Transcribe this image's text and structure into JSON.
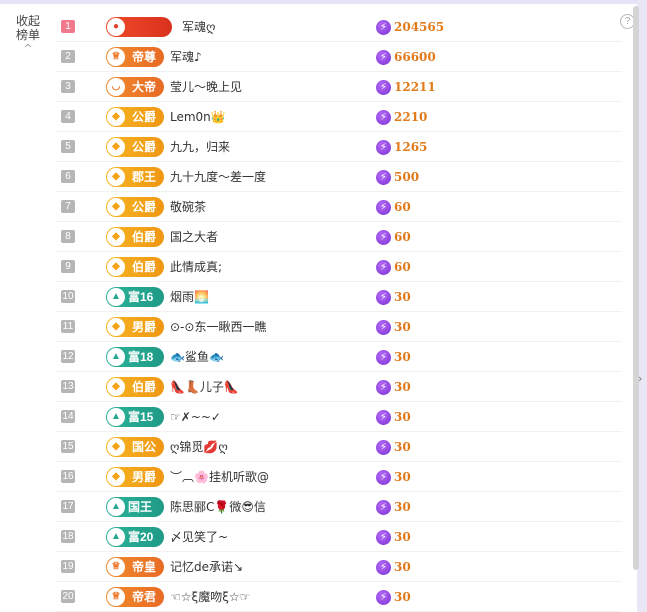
{
  "sidebar": {
    "collapse_label": "收起\n榜单",
    "caret": "^"
  },
  "help_icon": "?",
  "entries": [
    {
      "rank": "1",
      "badge": "",
      "style": "red",
      "icon": "●",
      "name": "军魂ღ",
      "points": "204565"
    },
    {
      "rank": "2",
      "badge": "帝尊",
      "style": "orange",
      "icon": "♕",
      "name": "军魂♪",
      "points": "66600"
    },
    {
      "rank": "3",
      "badge": "大帝",
      "style": "orange",
      "icon": "◡",
      "name": "莹儿～晚上见",
      "points": "12211"
    },
    {
      "rank": "4",
      "badge": "公爵",
      "style": "gold",
      "icon": "◆",
      "name": "Lem0n👑",
      "points": "2210"
    },
    {
      "rank": "5",
      "badge": "公爵",
      "style": "gold",
      "icon": "◆",
      "name": "九九，归来",
      "points": "1265"
    },
    {
      "rank": "6",
      "badge": "郡王",
      "style": "gold",
      "icon": "◆",
      "name": "九十九度～差一度",
      "points": "500"
    },
    {
      "rank": "7",
      "badge": "公爵",
      "style": "gold",
      "icon": "◆",
      "name": "敬碗茶",
      "points": "60"
    },
    {
      "rank": "8",
      "badge": "伯爵",
      "style": "gold",
      "icon": "◆",
      "name": "国之大者",
      "points": "60"
    },
    {
      "rank": "9",
      "badge": "伯爵",
      "style": "gold",
      "icon": "◆",
      "name": "此情成真;",
      "points": "60"
    },
    {
      "rank": "10",
      "badge": "富16",
      "style": "teal",
      "icon": "▲",
      "name": "烟雨🌅",
      "points": "30"
    },
    {
      "rank": "11",
      "badge": "男爵",
      "style": "gold",
      "icon": "◆",
      "name": "⊙-⊙东一瞅西一瞧",
      "points": "30"
    },
    {
      "rank": "12",
      "badge": "富18",
      "style": "teal",
      "icon": "▲",
      "name": "🐟鲨鱼🐟",
      "points": "30"
    },
    {
      "rank": "13",
      "badge": "伯爵",
      "style": "gold",
      "icon": "◆",
      "name": "👠👢儿子👠",
      "points": "30"
    },
    {
      "rank": "14",
      "badge": "富15",
      "style": "teal",
      "icon": "▲",
      "name": "☞✗~~✓",
      "points": "30"
    },
    {
      "rank": "15",
      "badge": "国公",
      "style": "gold",
      "icon": "◆",
      "name": "ღ锦觅💋ღ",
      "points": "30"
    },
    {
      "rank": "16",
      "badge": "男爵",
      "style": "gold",
      "icon": "◆",
      "name": "︶︹🌸挂机听歌@",
      "points": "30"
    },
    {
      "rank": "17",
      "badge": "国王",
      "style": "teal",
      "icon": "▲",
      "name": "陈思郦C🌹微😎信",
      "points": "30"
    },
    {
      "rank": "18",
      "badge": "富20",
      "style": "teal",
      "icon": "▲",
      "name": "〆见笑了~",
      "points": "30"
    },
    {
      "rank": "19",
      "badge": "帝皇",
      "style": "orange",
      "icon": "♕",
      "name": "记忆de承诺↘",
      "points": "30"
    },
    {
      "rank": "20",
      "badge": "帝君",
      "style": "orange",
      "icon": "♕",
      "name": "☜☆ξ魔吻ξ☆☞",
      "points": "30"
    }
  ],
  "colors": {
    "accent_points": "#e07a1a",
    "rank_top": "#f07a8c",
    "rank_default": "#b6b6b6",
    "badge_gold": "#f3a316",
    "badge_teal": "#24a68f",
    "badge_orange": "#ec7527"
  },
  "points_icon": "bolt-icon"
}
